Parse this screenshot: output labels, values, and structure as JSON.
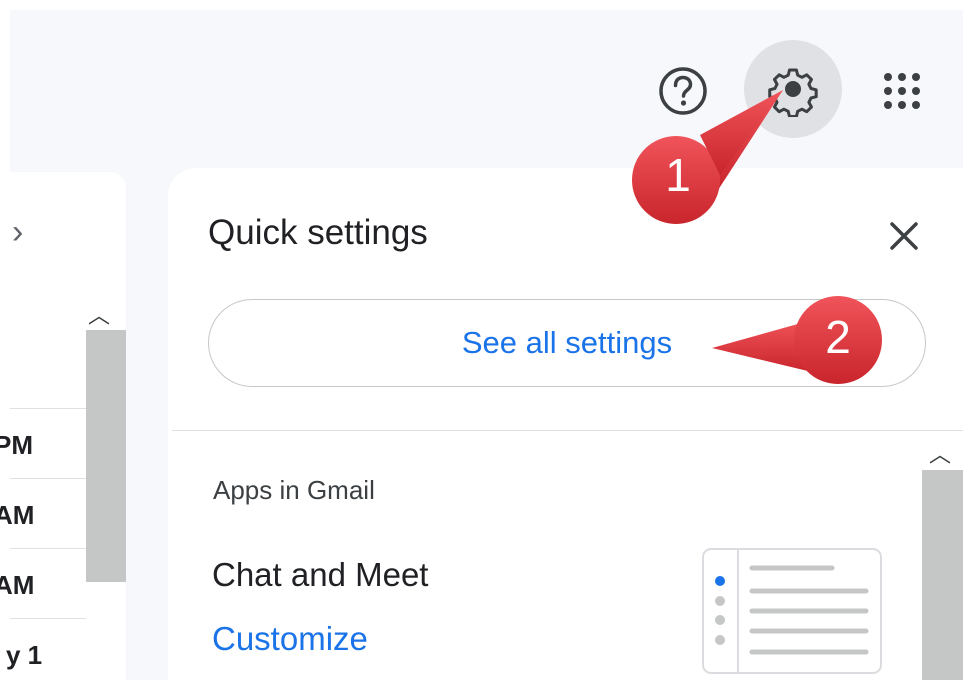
{
  "header": {
    "icons": {
      "help": "help-circle-icon",
      "settings": "gear-icon",
      "apps": "apps-grid-icon"
    }
  },
  "mail_list": {
    "nav_icon": "chevron-right-icon",
    "times": [
      "PM",
      "AM",
      "AM",
      "y 1"
    ]
  },
  "quick_settings": {
    "title": "Quick settings",
    "close_icon": "close-icon",
    "see_all_label": "See all settings",
    "section_label": "Apps in Gmail",
    "chat_label": "Chat and Meet",
    "customize_label": "Customize"
  },
  "callouts": [
    {
      "number": "1"
    },
    {
      "number": "2"
    }
  ],
  "colors": {
    "accent": "#1a73e8",
    "callout": "#e3343b",
    "gear_bg": "#dfe1e5",
    "page_bg": "#f6f8fc"
  }
}
